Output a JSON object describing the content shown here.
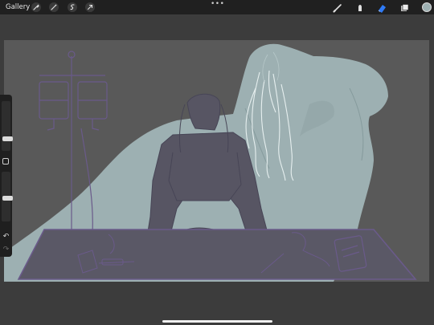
{
  "topbar": {
    "gallery_label": "Gallery",
    "left_tools": [
      "wrench-icon",
      "magic-wand-icon",
      "selection-icon",
      "transform-arrow-icon"
    ],
    "more_label": "•••",
    "right_tools": [
      "brush-icon",
      "smudge-icon",
      "eraser-icon",
      "layers-icon"
    ],
    "active_tool": "eraser-icon",
    "color_swatch": "#9db0b2"
  },
  "sidebar": {
    "brush_size": 0.18,
    "brush_opacity": 0.35,
    "undo_icon": "undo-icon",
    "redo_icon": "redo-icon"
  },
  "colors": {
    "background": "#3c3c3c",
    "canvas": "#595959",
    "ghost": "#9db0b2",
    "accent": "#2f7bf6",
    "line_dark": "#474556",
    "line_purple": "#6a5a8a"
  }
}
